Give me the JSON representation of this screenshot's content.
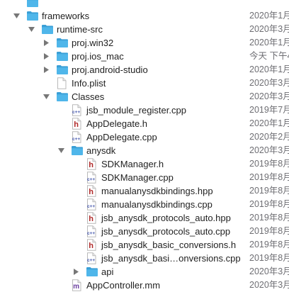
{
  "colors": {
    "folder": "#4fb6ea",
    "folder_dark": "#3a9fd6",
    "h_badge": "#b02a2a",
    "cpp_badge": "#3b4ea8",
    "mm_badge": "#6b3fa0"
  },
  "rows": [
    {
      "name": "",
      "date": "",
      "kind": "folder",
      "indent": 0,
      "disc": "none"
    },
    {
      "name": "frameworks",
      "date": "2020年1月",
      "kind": "folder",
      "indent": 0,
      "disc": "open"
    },
    {
      "name": "runtime-src",
      "date": "2020年3月",
      "kind": "folder",
      "indent": 1,
      "disc": "open"
    },
    {
      "name": "proj.win32",
      "date": "2020年1月",
      "kind": "folder",
      "indent": 2,
      "disc": "closed"
    },
    {
      "name": "proj.ios_mac",
      "date": "今天 下午4",
      "kind": "folder",
      "indent": 2,
      "disc": "closed"
    },
    {
      "name": "proj.android-studio",
      "date": "2020年1月",
      "kind": "folder",
      "indent": 2,
      "disc": "closed"
    },
    {
      "name": "Info.plist",
      "date": "2020年3月",
      "kind": "plist",
      "indent": 2,
      "disc": "none"
    },
    {
      "name": "Classes",
      "date": "2020年3月",
      "kind": "folder",
      "indent": 2,
      "disc": "open"
    },
    {
      "name": "jsb_module_register.cpp",
      "date": "2019年7月",
      "kind": "cpp",
      "indent": 3,
      "disc": "none"
    },
    {
      "name": "AppDelegate.h",
      "date": "2020年1月",
      "kind": "h",
      "indent": 3,
      "disc": "none"
    },
    {
      "name": "AppDelegate.cpp",
      "date": "2020年2月",
      "kind": "cpp",
      "indent": 3,
      "disc": "none"
    },
    {
      "name": "anysdk",
      "date": "2020年3月",
      "kind": "folder",
      "indent": 3,
      "disc": "open"
    },
    {
      "name": "SDKManager.h",
      "date": "2019年8月",
      "kind": "h",
      "indent": 4,
      "disc": "none"
    },
    {
      "name": "SDKManager.cpp",
      "date": "2019年8月",
      "kind": "cpp",
      "indent": 4,
      "disc": "none"
    },
    {
      "name": "manualanysdkbindings.hpp",
      "date": "2019年8月",
      "kind": "h",
      "indent": 4,
      "disc": "none"
    },
    {
      "name": "manualanysdkbindings.cpp",
      "date": "2019年8月",
      "kind": "cpp",
      "indent": 4,
      "disc": "none"
    },
    {
      "name": "jsb_anysdk_protocols_auto.hpp",
      "date": "2019年8月",
      "kind": "h",
      "indent": 4,
      "disc": "none"
    },
    {
      "name": "jsb_anysdk_protocols_auto.cpp",
      "date": "2019年8月",
      "kind": "cpp",
      "indent": 4,
      "disc": "none"
    },
    {
      "name": "jsb_anysdk_basic_conversions.h",
      "date": "2019年8月",
      "kind": "h",
      "indent": 4,
      "disc": "none"
    },
    {
      "name": "jsb_anysdk_basi…onversions.cpp",
      "date": "2019年8月",
      "kind": "cpp",
      "indent": 4,
      "disc": "none"
    },
    {
      "name": "api",
      "date": "2020年3月",
      "kind": "folder",
      "indent": 4,
      "disc": "closed"
    },
    {
      "name": "AppController.mm",
      "date": "2020年3月",
      "kind": "mm",
      "indent": 3,
      "disc": "none"
    }
  ]
}
